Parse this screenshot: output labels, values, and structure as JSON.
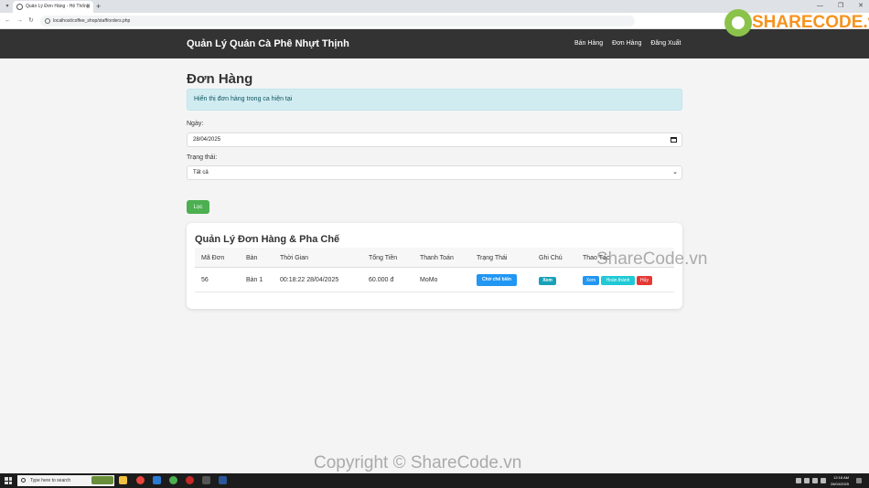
{
  "browser": {
    "tab_title": "Quản Lý Đơn Hàng - Hệ Thống",
    "url": "localhost/coffee_shop/staff/orders.php"
  },
  "navbar": {
    "brand": "Quản Lý Quán Cà Phê Nhựt Thịnh",
    "links": [
      "Bán Hàng",
      "Đơn Hàng",
      "Đăng Xuất"
    ]
  },
  "page": {
    "title": "Đơn Hàng",
    "alert": "Hiển thị đơn hàng trong ca hiện tại"
  },
  "filters": {
    "date_label": "Ngày:",
    "date_value": "28/04/2025",
    "status_label": "Trạng thái:",
    "status_value": "Tất cả",
    "submit_label": "Lọc"
  },
  "orders": {
    "title": "Quản Lý Đơn Hàng & Pha Chế",
    "columns": [
      "Mã Đơn",
      "Bàn",
      "Thời Gian",
      "Tổng Tiền",
      "Thanh Toán",
      "Trạng Thái",
      "Ghi Chú",
      "Thao Tác"
    ],
    "rows": [
      {
        "id": "56",
        "table": "Bàn 1",
        "time": "00:18:22 28/04/2025",
        "total": "60.000 đ",
        "payment": "MoMo",
        "status": "Chờ chế biến",
        "note": "Xem",
        "actions": [
          "Xem",
          "Hoàn thành",
          "Hủy"
        ]
      }
    ]
  },
  "watermarks": {
    "logo": "SHARECODE.vn",
    "middle": "ShareCode.vn",
    "bottom": "Copyright © ShareCode.vn"
  },
  "taskbar": {
    "search_placeholder": "Type here to search",
    "time": "12:18 AM",
    "date": "28/04/2025"
  },
  "colors": {
    "navbar": "#333333",
    "alert_bg": "#d1ecf1",
    "primary": "#2196f3",
    "success": "#4caf50",
    "info": "#17a2b8",
    "danger": "#e53935",
    "teal": "#20c9d6",
    "watermark_orange": "#f7931e"
  }
}
